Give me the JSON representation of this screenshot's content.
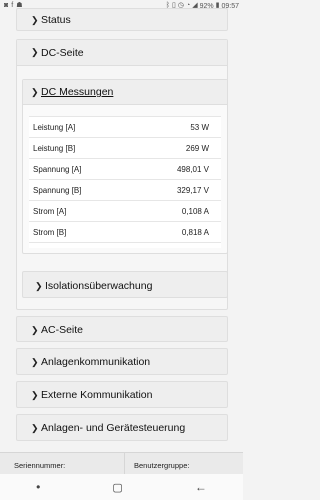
{
  "status_bar": {
    "left_icons": [
      "camera-icon",
      "facebook-icon",
      "android-icon"
    ],
    "battery": "92%",
    "time": "09:57"
  },
  "sections": {
    "status": "Status",
    "dc_seite": "DC-Seite",
    "dc_messungen": "DC Messungen",
    "isolation": "Isolationsüberwachung",
    "ac_seite": "AC-Seite",
    "anlagenkommunikation": "Anlagenkommunikation",
    "externe": "Externe Kommunikation",
    "steuerung": "Anlagen- und Gerätesteuerung"
  },
  "measurements": [
    {
      "label": "Leistung [A]",
      "value": "53 W"
    },
    {
      "label": "Leistung [B]",
      "value": "269 W"
    },
    {
      "label": "Spannung [A]",
      "value": "498,01 V"
    },
    {
      "label": "Spannung [B]",
      "value": "329,17 V"
    },
    {
      "label": "Strom [A]",
      "value": "0,108 A"
    },
    {
      "label": "Strom [B]",
      "value": "0,818 A"
    }
  ],
  "footer": {
    "serial_label": "Seriennummer:",
    "group_label": "Benutzergruppe:"
  },
  "nav": {
    "home": "○",
    "back": "←"
  }
}
